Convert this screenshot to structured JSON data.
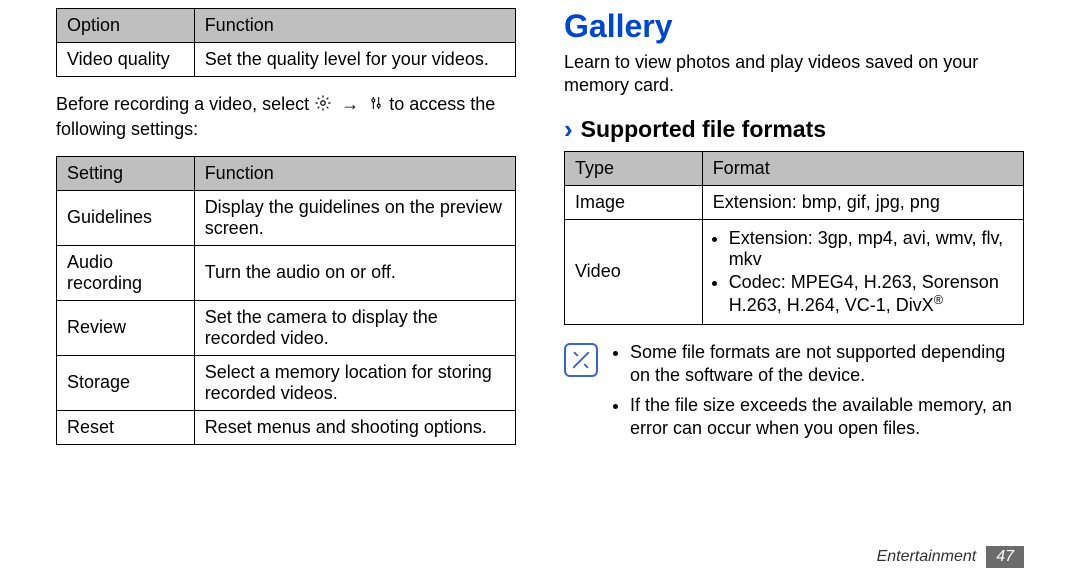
{
  "left": {
    "table1": {
      "headers": [
        "Option",
        "Function"
      ],
      "rows": [
        [
          "Video quality",
          "Set the quality level for your videos."
        ]
      ]
    },
    "intro_a": "Before recording a video, select ",
    "intro_arrow": "→",
    "intro_b": " to access the following settings:",
    "table2": {
      "headers": [
        "Setting",
        "Function"
      ],
      "rows": [
        [
          "Guidelines",
          "Display the guidelines on the preview screen."
        ],
        [
          "Audio recording",
          "Turn the audio on or off."
        ],
        [
          "Review",
          "Set the camera to display the recorded video."
        ],
        [
          "Storage",
          "Select a memory location for storing recorded videos."
        ],
        [
          "Reset",
          "Reset menus and shooting options."
        ]
      ]
    }
  },
  "right": {
    "title": "Gallery",
    "lead": "Learn to view photos and play videos saved on your memory card.",
    "subhead": "Supported file formats",
    "table": {
      "headers": [
        "Type",
        "Format"
      ],
      "image_row": [
        "Image",
        "Extension: bmp, gif, jpg, png"
      ],
      "video_label": "Video",
      "video_bullets": [
        "Extension: 3gp, mp4, avi, wmv, flv, mkv",
        "Codec: MPEG4, H.263, Sorenson H.263, H.264, VC-1, DivX"
      ],
      "divx_reg": "®"
    },
    "notes": [
      "Some file formats are not supported depending on the software of the device.",
      "If the file size exceeds the available memory, an error can occur when you open files."
    ]
  },
  "footer": {
    "section": "Entertainment",
    "page": "47"
  }
}
